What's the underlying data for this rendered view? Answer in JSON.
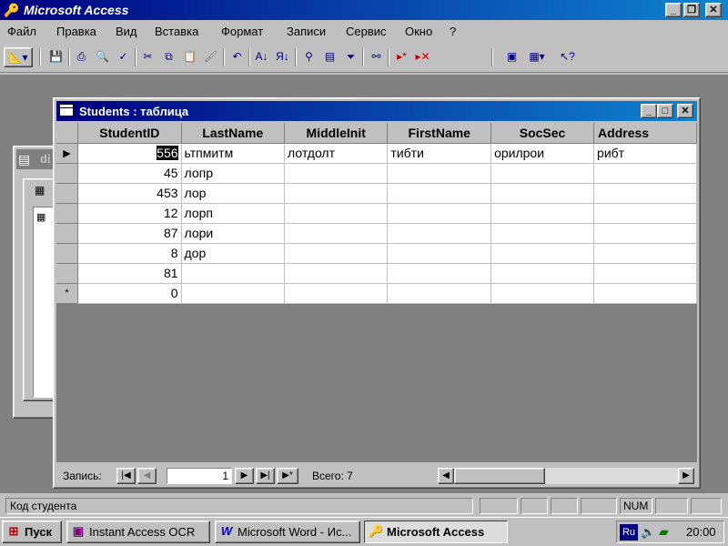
{
  "app": {
    "title": "Microsoft Access"
  },
  "menu": [
    "Файл",
    "Правка",
    "Вид",
    "Вставка",
    "Формат",
    "Записи",
    "Сервис",
    "Окно",
    "?"
  ],
  "toolbar": {
    "icons": [
      "view-design-icon",
      "save-icon",
      "print-icon",
      "print-preview-icon",
      "spelling-icon",
      "cut-icon",
      "copy-icon",
      "paste-icon",
      "format-painter-icon",
      "undo-icon",
      "sort-ascending-icon",
      "sort-descending-icon",
      "filter-by-selection-icon",
      "filter-by-form-icon",
      "apply-filter-icon",
      "find-icon",
      "new-record-icon",
      "delete-record-icon",
      "database-window-icon",
      "new-object-icon",
      "help-icon"
    ]
  },
  "background_window": {
    "title_fragment": "di"
  },
  "datasheet": {
    "title": "Students : таблица",
    "columns": [
      "StudentID",
      "LastName",
      "MiddleInit",
      "FirstName",
      "SocSec",
      "Address"
    ],
    "rows": [
      [
        "556",
        "ьтпмитм",
        "лотдолт",
        "тибти",
        "орилрои",
        "рибт"
      ],
      [
        "45",
        "лопр",
        "",
        "",
        "",
        ""
      ],
      [
        "453",
        "лор",
        "",
        "",
        "",
        ""
      ],
      [
        "12",
        "лорп",
        "",
        "",
        "",
        ""
      ],
      [
        "87",
        "лори",
        "",
        "",
        "",
        ""
      ],
      [
        "8",
        "дор",
        "",
        "",
        "",
        ""
      ],
      [
        "81",
        "",
        "",
        "",
        "",
        ""
      ],
      [
        "0",
        "",
        "",
        "",
        "",
        ""
      ]
    ],
    "row_markers": [
      "▶",
      "",
      "",
      "",
      "",
      "",
      "",
      "*"
    ],
    "nav": {
      "label": "Запись:",
      "current_record": "1",
      "total": "Всего: 7"
    }
  },
  "status": {
    "text": "Код студента",
    "num": "NUM"
  },
  "taskbar": {
    "start": "Пуск",
    "buttons": [
      "Instant Access OCR",
      "Microsoft Word - Ис...",
      "Microsoft Access"
    ],
    "lang": "Ru",
    "clock": "20:00"
  }
}
